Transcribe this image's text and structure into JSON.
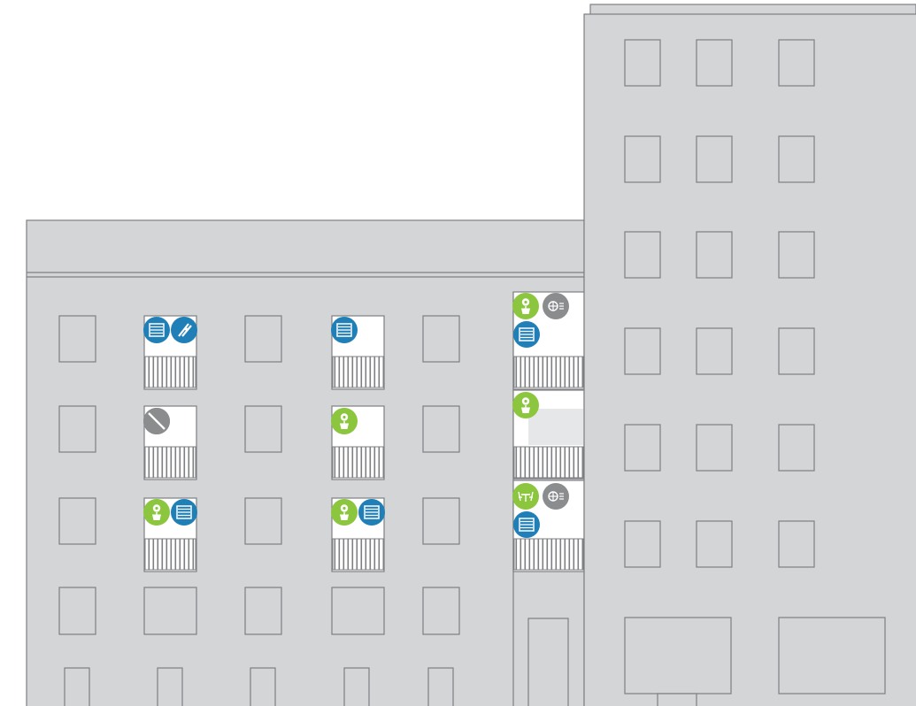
{
  "colors": {
    "background": "#ffffff",
    "facade": "#d4d5d7",
    "outline": "#7e7f82",
    "window_open": "#ffffff",
    "green": "#8cc63f",
    "blue": "#1f7fb6",
    "gray": "#8a8c8e",
    "railing": "#ffffff"
  },
  "icon_legend": [
    {
      "key": "blinds",
      "icon": "window-blinds-icon",
      "color": "blue"
    },
    {
      "key": "laundry",
      "icon": "clothes-peg-icon",
      "color": "blue"
    },
    {
      "key": "forbidden",
      "icon": "prohibited-icon",
      "color": "gray"
    },
    {
      "key": "plant",
      "icon": "potted-plant-icon",
      "color": "green"
    },
    {
      "key": "aircon",
      "icon": "air-conditioner-icon",
      "color": "gray"
    },
    {
      "key": "furniture",
      "icon": "patio-furniture-icon",
      "color": "green"
    }
  ],
  "balconies": [
    {
      "name": "balcony-col2-floor1",
      "icons": [
        "blinds",
        "laundry"
      ]
    },
    {
      "name": "balcony-col4-floor1",
      "icons": [
        "blinds"
      ]
    },
    {
      "name": "balcony-col6-floor1",
      "icons": [
        "plant",
        "aircon",
        "blinds"
      ]
    },
    {
      "name": "balcony-col2-floor2",
      "icons": [
        "forbidden"
      ]
    },
    {
      "name": "balcony-col4-floor2",
      "icons": [
        "plant"
      ]
    },
    {
      "name": "balcony-col6-floor2",
      "icons": [
        "plant"
      ]
    },
    {
      "name": "balcony-col2-floor3",
      "icons": [
        "plant",
        "blinds"
      ]
    },
    {
      "name": "balcony-col4-floor3",
      "icons": [
        "plant",
        "blinds"
      ]
    },
    {
      "name": "balcony-col6-floor3",
      "icons": [
        "furniture",
        "aircon",
        "blinds"
      ]
    }
  ]
}
